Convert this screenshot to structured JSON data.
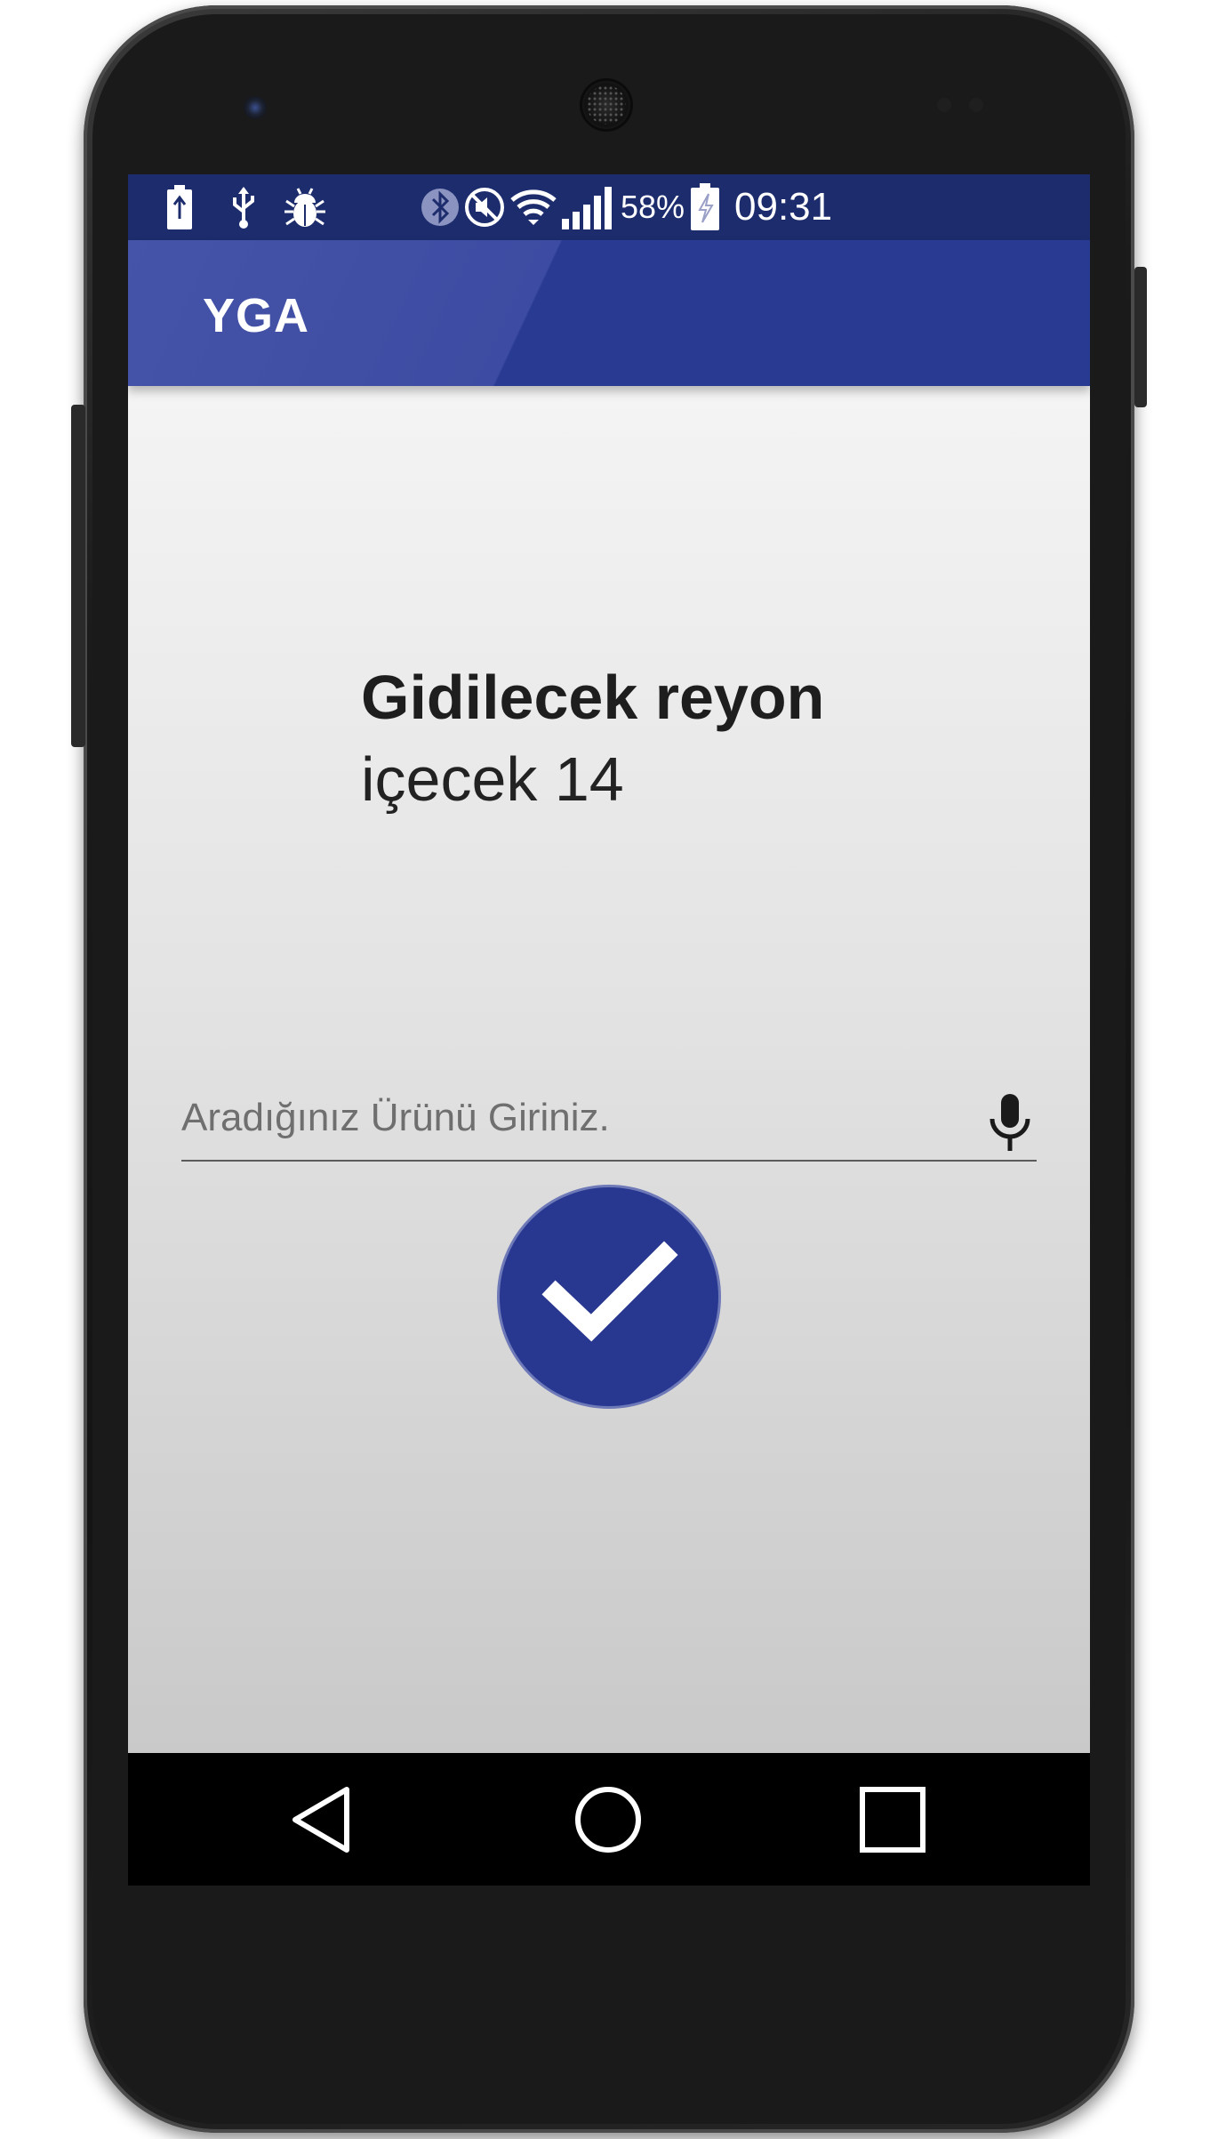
{
  "status_bar": {
    "left_icons": [
      "battery-charging-icon",
      "usb-icon",
      "debug-bug-icon"
    ],
    "right_icons": [
      "bluetooth-icon",
      "mute-icon",
      "wifi-icon",
      "signal-icon",
      "battery-icon"
    ],
    "battery_percent": "58%",
    "time": "09:31"
  },
  "app_bar": {
    "title": "YGA"
  },
  "main": {
    "destination_label": "Gidilecek reyon",
    "destination_value": "içecek 14",
    "search": {
      "value": "",
      "placeholder": "Aradığınız Ürünü Giriniz."
    },
    "confirm_icon": "check-icon"
  },
  "nav_bar": {
    "items": [
      "back-icon",
      "home-icon",
      "recents-icon"
    ]
  },
  "colors": {
    "primary": "#283a92",
    "primary_dark": "#1c2c6d",
    "accent": "#283891"
  }
}
